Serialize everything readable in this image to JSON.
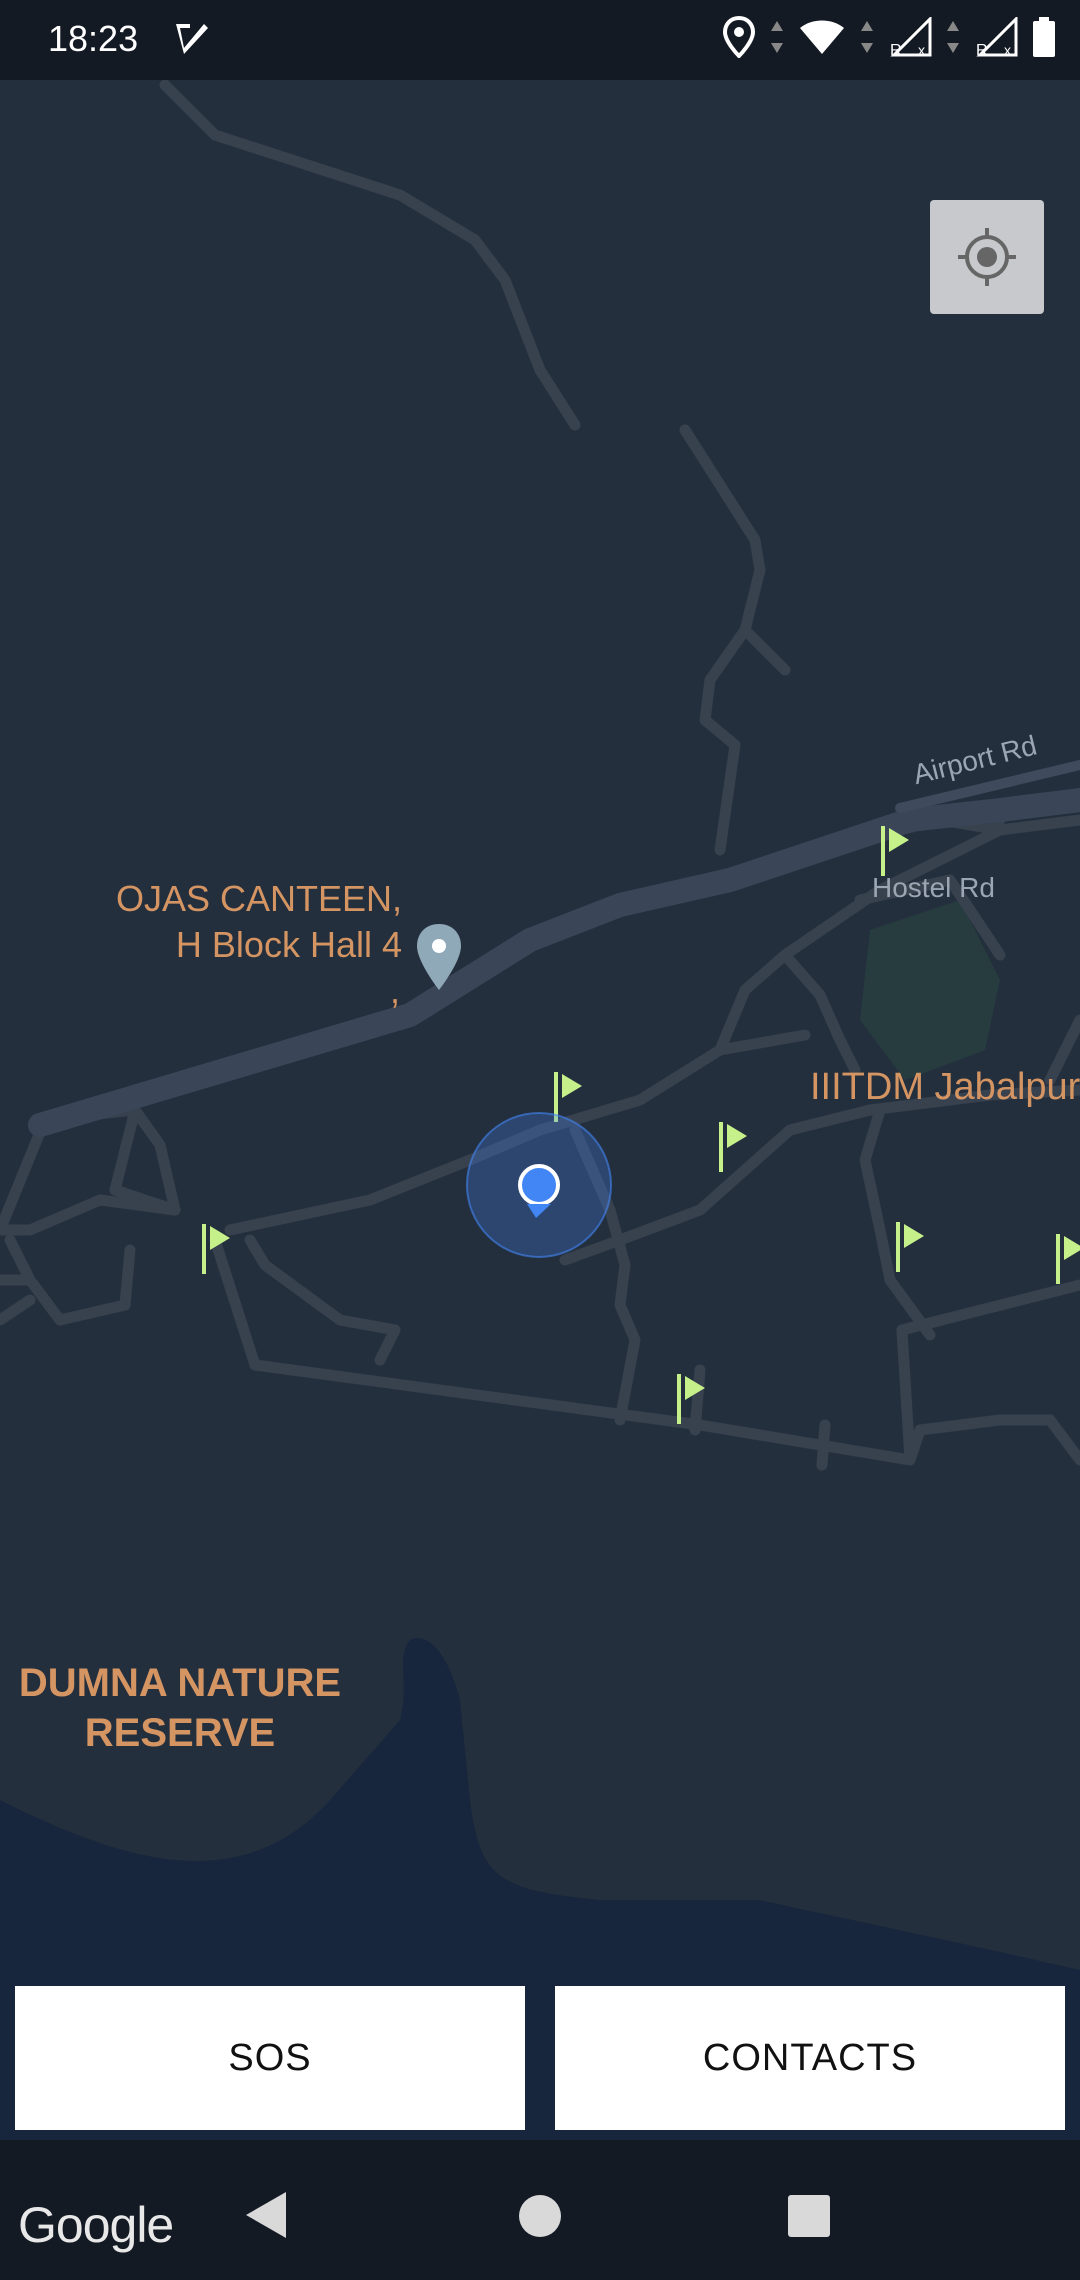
{
  "status_bar": {
    "time": "18:23",
    "icons": [
      "check-app-icon",
      "location-icon",
      "wifi-icon",
      "signal-r-icon",
      "signal-r-icon",
      "battery-icon"
    ]
  },
  "map": {
    "poi_label_line1": "OJAS CANTEEN,",
    "poi_label_line2": "H Block Hall 4",
    "poi_label_line3": ",",
    "campus_label": "IIITDM Jabalpur",
    "reserve_label_line1": "DUMNA NATURE",
    "reserve_label_line2": "RESERVE",
    "road_airport": "Airport Rd",
    "road_hostel": "Hostel Rd",
    "label_color": "#d59563",
    "flag_color": "#c6f08a",
    "my_location_color": "#4285f4"
  },
  "actions": {
    "sos_label": "SOS",
    "contacts_label": "CONTACTS"
  },
  "attribution": {
    "google": "Google"
  }
}
